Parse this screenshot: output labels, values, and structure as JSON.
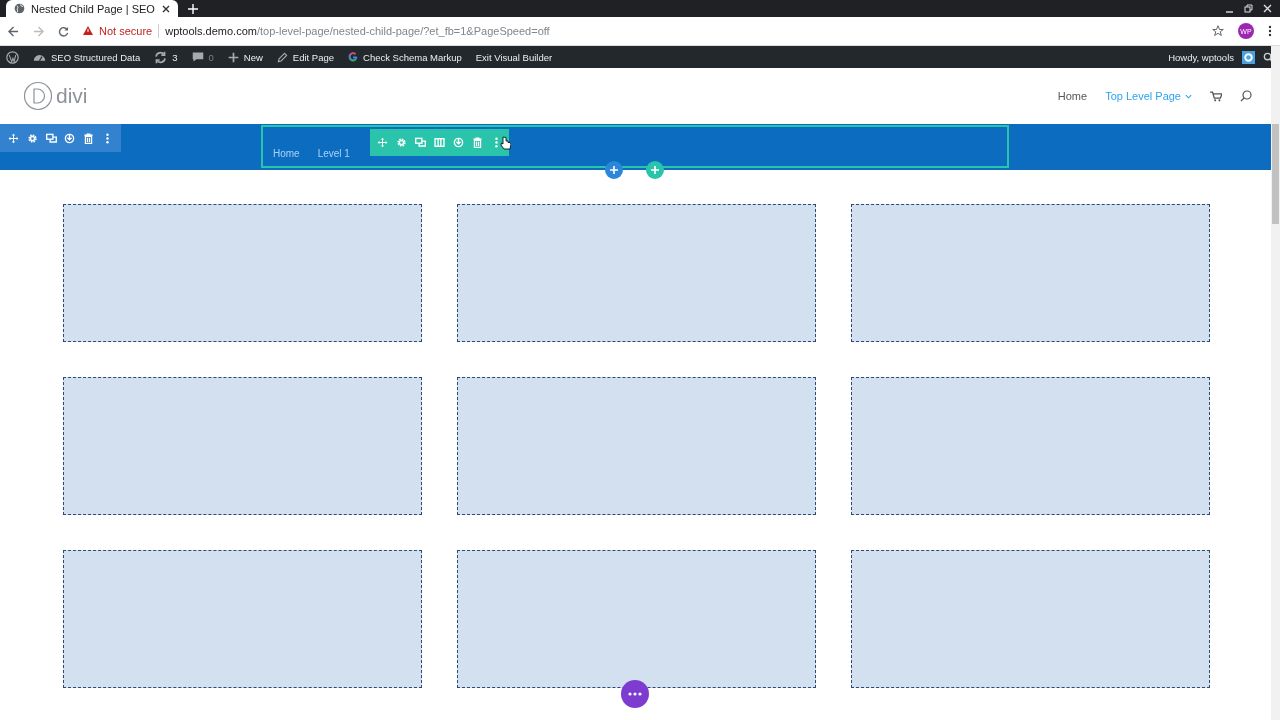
{
  "browser": {
    "tab_title": "Nested Child Page | SEO",
    "security": "Not secure",
    "url_host": "wptools.demo.com",
    "url_path": "/top-level-page/nested-child-page/?et_fb=1&PageSpeed=off",
    "profile": "WP"
  },
  "admin_bar": {
    "items": [
      {
        "kind": "gauge",
        "label": "SEO Structured Data"
      },
      {
        "kind": "updates",
        "label": "3"
      },
      {
        "kind": "comments",
        "label": "0"
      },
      {
        "kind": "plus",
        "label": "New"
      },
      {
        "kind": "pencil",
        "label": "Edit Page"
      },
      {
        "kind": "google",
        "label": "Check Schema Markup"
      },
      {
        "kind": "none",
        "label": "Exit Visual Builder"
      }
    ],
    "greeting": "Howdy, wptools"
  },
  "header": {
    "logo": "divi",
    "nav": [
      {
        "label": "Home",
        "selected": false,
        "dropdown": false
      },
      {
        "label": "Top Level Page",
        "selected": true,
        "dropdown": true
      }
    ]
  },
  "section": {
    "breadcrumb": [
      "Home",
      "Level 1"
    ]
  }
}
